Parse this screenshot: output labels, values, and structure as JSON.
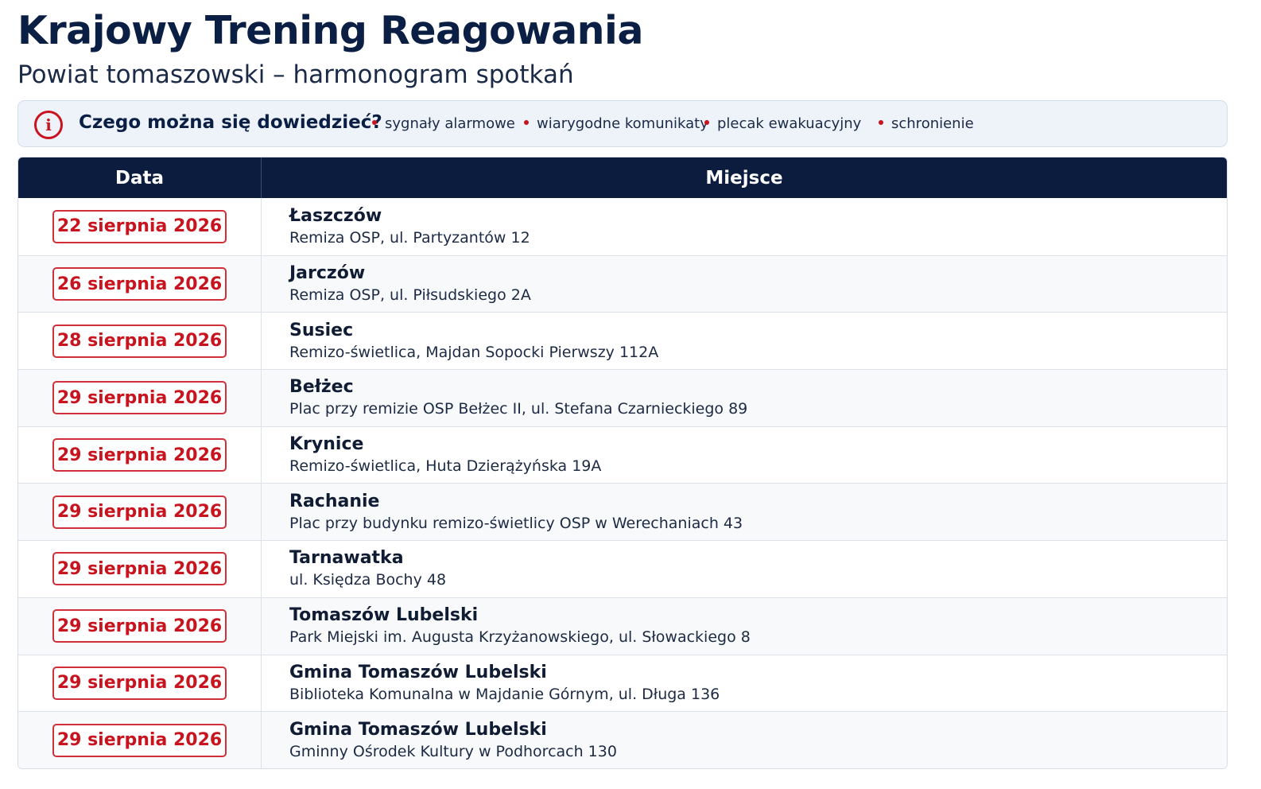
{
  "header": {
    "title": "Krajowy Trening Reagowania",
    "subtitle": "Powiat tomaszowski – harmonogram spotkań"
  },
  "info": {
    "icon": "info-icon",
    "question": "Czego można się dowiedzieć?",
    "topics": [
      "sygnały alarmowe",
      "wiarygodne komunikaty",
      "plecak ewakuacyjny",
      "schronienie"
    ]
  },
  "table": {
    "columns": [
      "Data",
      "Miejsce"
    ],
    "rows": [
      {
        "date": "22 sierpnia 2026",
        "name": "Łaszczów",
        "address": "Remiza OSP, ul. Partyzantów 12"
      },
      {
        "date": "26 sierpnia 2026",
        "name": "Jarczów",
        "address": "Remiza OSP, ul. Piłsudskiego 2A"
      },
      {
        "date": "28 sierpnia 2026",
        "name": "Susiec",
        "address": "Remizo-świetlica, Majdan Sopocki Pierwszy 112A"
      },
      {
        "date": "29 sierpnia 2026",
        "name": "Bełżec",
        "address": "Plac przy remizie OSP Bełżec II, ul. Stefana Czarnieckiego 89"
      },
      {
        "date": "29 sierpnia 2026",
        "name": "Krynice",
        "address": "Remizo-świetlica, Huta Dzierążyńska 19A"
      },
      {
        "date": "29 sierpnia 2026",
        "name": "Rachanie",
        "address": "Plac przy budynku remizo-świetlicy OSP w Werechaniach 43"
      },
      {
        "date": "29 sierpnia 2026",
        "name": "Tarnawatka",
        "address": "ul. Księdza Bochy 48"
      },
      {
        "date": "29 sierpnia 2026",
        "name": "Tomaszów Lubelski",
        "address": "Park Miejski im. Augusta Krzyżanowskiego, ul. Słowackiego 8"
      },
      {
        "date": "29 sierpnia 2026",
        "name": "Gmina Tomaszów Lubelski",
        "address": "Biblioteka Komunalna w Majdanie Górnym, ul. Długa 136"
      },
      {
        "date": "29 sierpnia 2026",
        "name": "Gmina Tomaszów Lubelski",
        "address": "Gminny Ośrodek Kultury w Podhorcach 130"
      }
    ]
  },
  "colors": {
    "navy": "#0b1c3f",
    "accent_red": "#c8141f",
    "info_bg": "#eef3fa"
  }
}
